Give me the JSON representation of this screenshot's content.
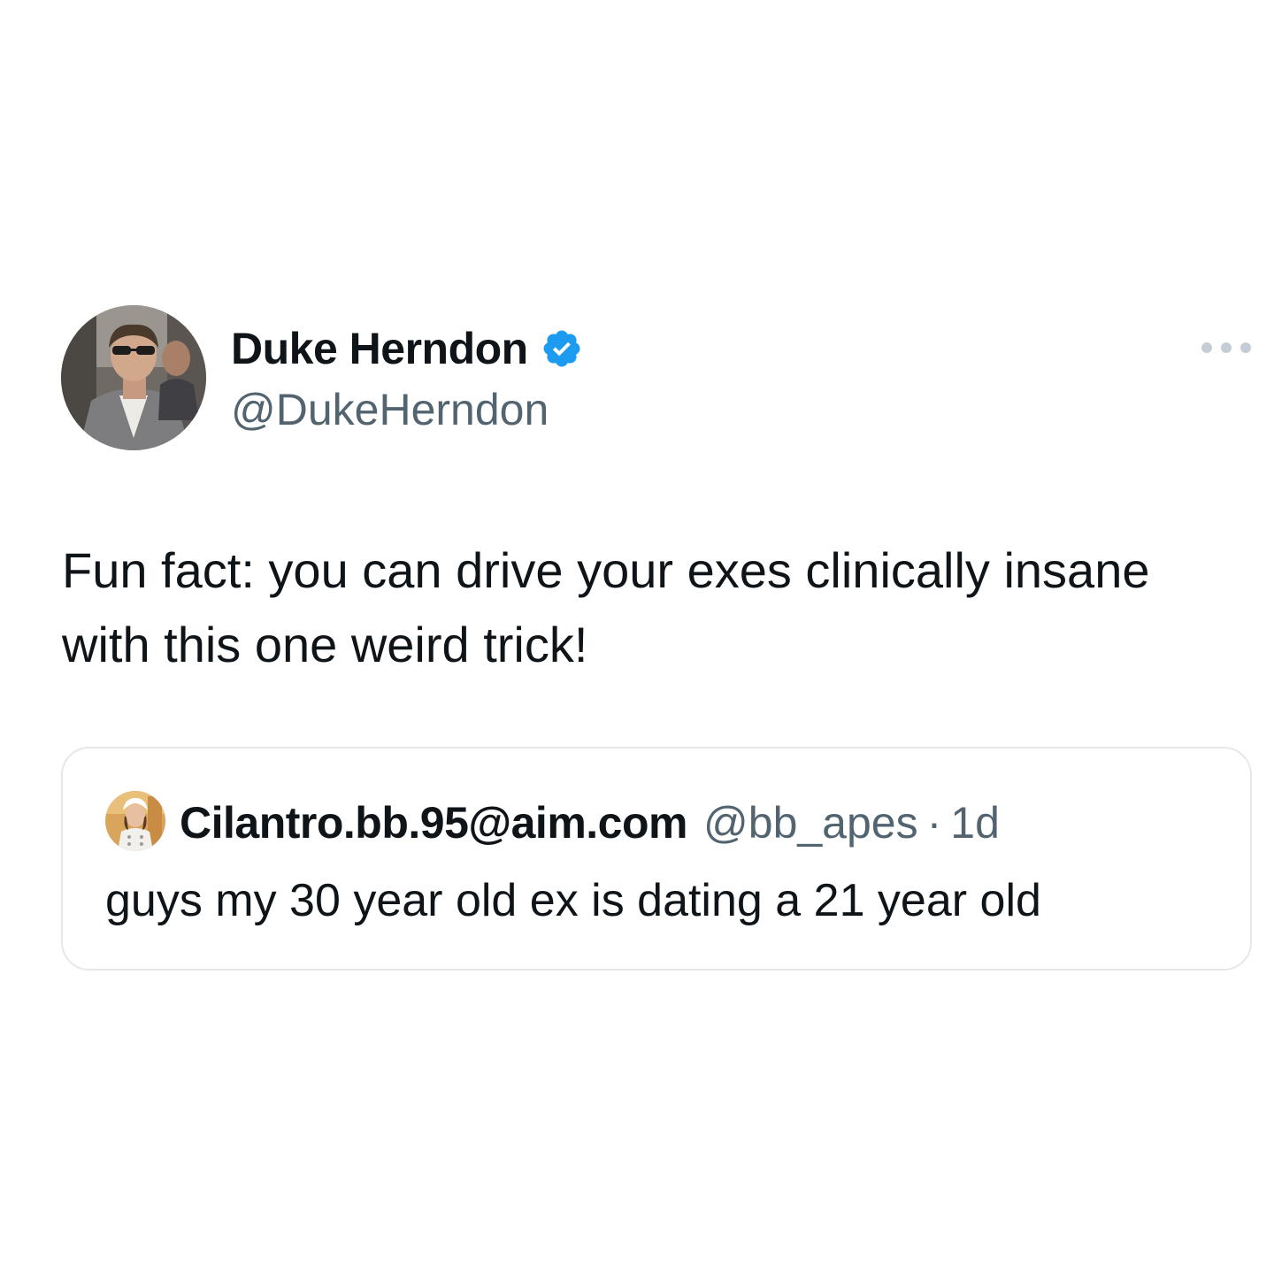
{
  "colors": {
    "background": "#ffffff",
    "text_primary": "#0f1419",
    "text_secondary": "#536471",
    "verified_badge": "#1d9bf0",
    "quote_border": "#e4e8eb",
    "more_dots": "#c4cdd5"
  },
  "tweet": {
    "author": {
      "name": "Duke Herndon",
      "handle": "@DukeHerndon",
      "verified": true,
      "avatar_icon": "profile-photo-avatar",
      "badge_icon": "verified-badge-icon"
    },
    "more_icon": "more-options-icon",
    "text": "Fun fact: you can drive your exes clinically insane with this one weird trick!",
    "quoted_tweet": {
      "author": {
        "name": "Cilantro.bb.95@aim.com",
        "handle": "@bb_apes",
        "avatar_icon": "profile-photo-avatar"
      },
      "separator": "·",
      "time": "1d",
      "text": "guys my 30 year old ex is dating a 21 year old"
    }
  }
}
